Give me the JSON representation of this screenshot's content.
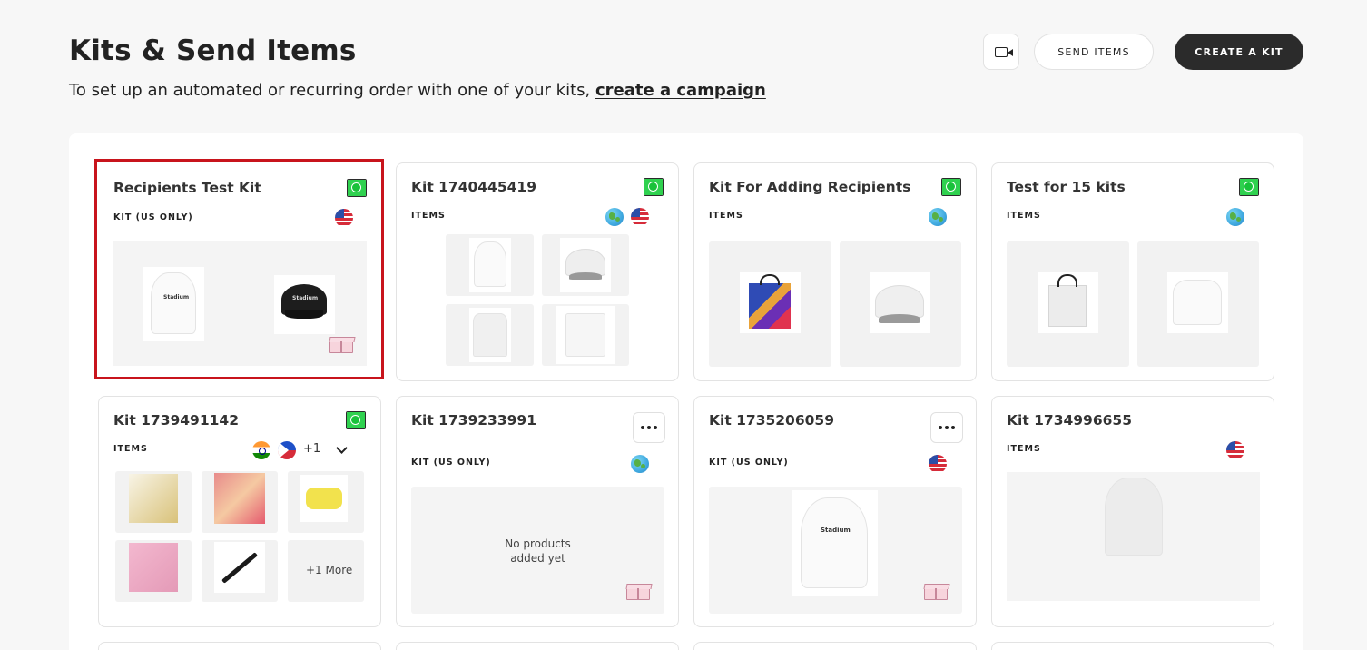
{
  "header": {
    "title": "Kits & Send Items",
    "subtitle_prefix": "To set up an automated or recurring order with one of your kits,",
    "subtitle_link": "create a campaign",
    "video_icon": "video-camera-icon",
    "send_items_label": "SEND ITEMS",
    "create_kit_label": "CREATE A KIT"
  },
  "kits": [
    {
      "name": "Recipients Test Kit",
      "type": "KIT (US ONLY)",
      "active": true,
      "regions": [
        "us-flag-icon"
      ],
      "selected": true
    },
    {
      "name": "Kit 1740445419",
      "type": "ITEMS",
      "active": true,
      "regions": [
        "globe-icon",
        "us-flag-icon"
      ]
    },
    {
      "name": "Kit For Adding Recipients",
      "type": "ITEMS",
      "active": true,
      "regions": [
        "globe-icon"
      ]
    },
    {
      "name": "Test for 15 kits",
      "type": "ITEMS",
      "active": true,
      "regions": [
        "globe-icon"
      ]
    },
    {
      "name": "Kit 1739491142",
      "type": "ITEMS",
      "active": true,
      "regions": [
        "india-flag-icon",
        "philippines-flag-icon"
      ],
      "extra_regions": "+1",
      "more_products": "+1 More"
    },
    {
      "name": "Kit 1739233991",
      "type": "KIT (US ONLY)",
      "active": false,
      "regions": [
        "globe-icon"
      ],
      "empty_text_1": "No products",
      "empty_text_2": "added yet"
    },
    {
      "name": "Kit 1735206059",
      "type": "KIT (US ONLY)",
      "active": false,
      "regions": [
        "us-flag-icon"
      ]
    },
    {
      "name": "Kit 1734996655",
      "type": "ITEMS",
      "active": false,
      "regions": [
        "us-flag-icon"
      ]
    }
  ],
  "colors": {
    "accent_dark": "#2b2b2b",
    "active_green": "#2fd14f",
    "selected_border": "#c8141c"
  }
}
